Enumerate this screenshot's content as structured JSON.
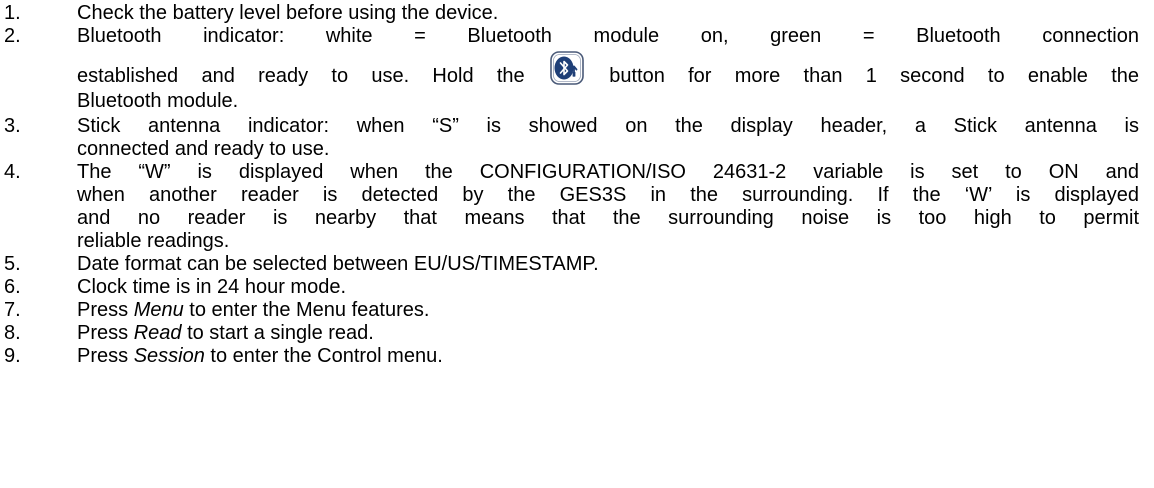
{
  "items": [
    {
      "num": "1.",
      "text": "Check the battery level before using the device."
    },
    {
      "num": "2.",
      "line1": "Bluetooth indicator: white = Bluetooth module on, green = Bluetooth connection",
      "line2_before": "established and ready to use. Hold the",
      "line2_after": "button for more than 1 second to enable the",
      "line3": "Bluetooth module.",
      "icon": "bluetooth-button-icon"
    },
    {
      "num": "3.",
      "line1": "Stick antenna indicator: when “S” is showed on the display header, a Stick antenna is",
      "line2": "connected and ready to use."
    },
    {
      "num": "4.",
      "line1": "The “W” is displayed when the CONFIGURATION/ISO 24631-2 variable is set to ON and",
      "line2": "when another reader is detected by the GES3S in the surrounding. If the ‘W’ is displayed",
      "line3": "and no reader is nearby that means that the surrounding noise is too high to permit",
      "line4": "reliable readings."
    },
    {
      "num": "5.",
      "text": "Date format can be selected between EU/US/TIMESTAMP."
    },
    {
      "num": "6.",
      "text": "Clock time is in 24 hour mode."
    },
    {
      "num": "7.",
      "before": "Press",
      "em": "Menu",
      "after": "to enter the Menu features."
    },
    {
      "num": "8.",
      "before": "Press",
      "em": "Read",
      "after": "to start a single read."
    },
    {
      "num": "9.",
      "before": "Press",
      "em": "Session",
      "after": "to enter the Control menu."
    }
  ],
  "colors": {
    "text": "#000000",
    "icon_fill": "#1f3f77",
    "icon_border": "#4a5a78"
  }
}
